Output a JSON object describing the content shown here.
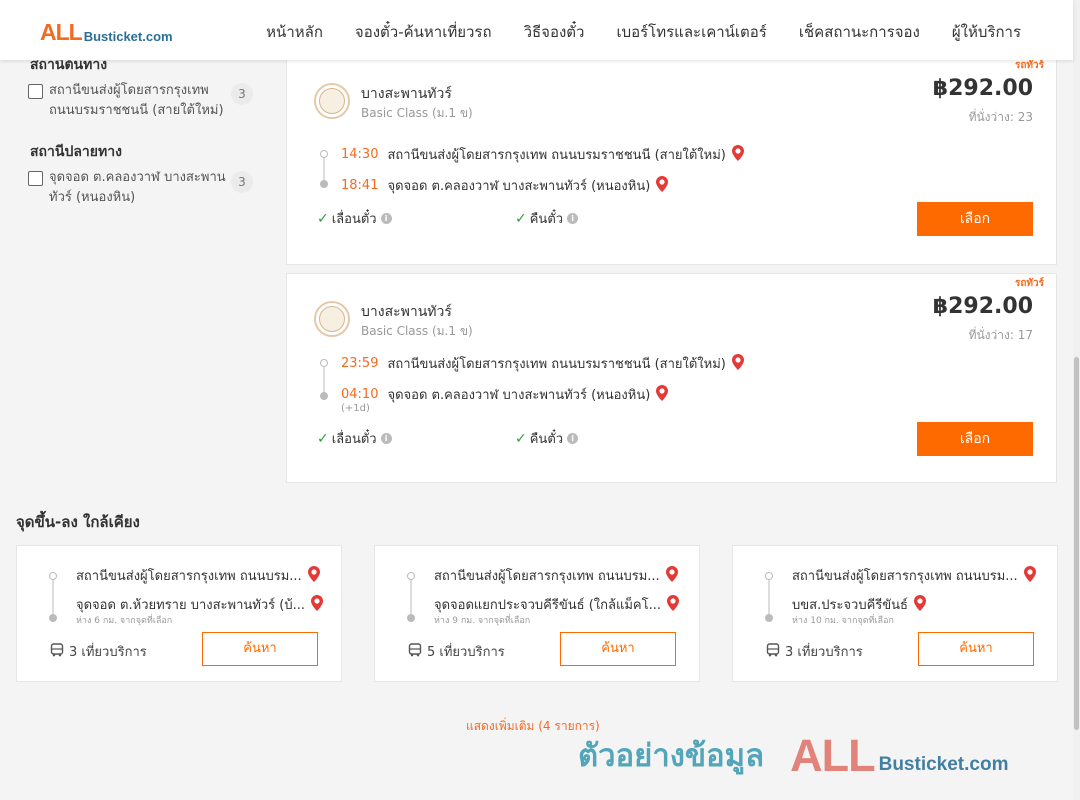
{
  "header": {
    "logo_all": "ALL",
    "logo_rest": "Busticket.com",
    "nav": [
      "หน้าหลัก",
      "จองตั๋ว-ค้นหาเที่ยวรถ",
      "วิธีจองตั๋ว",
      "เบอร์โทรและเคาน์เตอร์",
      "เช็คสถานะการจอง",
      "ผู้ให้บริการ"
    ]
  },
  "filters": {
    "origin_heading": "สถานีต้นทาง",
    "origin_items": [
      {
        "label": "สถานีขนส่งผู้โดยสารกรุงเทพ ถนนบรมราชชนนี (สายใต้ใหม่)",
        "count": "3"
      }
    ],
    "destination_heading": "สถานีปลายทาง",
    "destination_items": [
      {
        "label": "จุดจอด ต.คลองวาฬ บางสะพานทัวร์ (หนองหิน)",
        "count": "3"
      }
    ]
  },
  "trips": [
    {
      "tag": "รถทัวร์",
      "operator": "บางสะพานทัวร์",
      "class": "Basic Class (ม.1 ข)",
      "price": "฿292.00",
      "seats": "ที่นั่งว่าง: 23",
      "depart_time": "14:30",
      "depart_station": "สถานีขนส่งผู้โดยสารกรุงเทพ ถนนบรมราชชนนี (สายใต้ใหม่)",
      "arrive_time": "18:41",
      "arrive_station": "จุดจอด ต.คลองวาฬ บางสะพานทัวร์ (หนองหิน)",
      "next_day": "",
      "feature_1": "เลื่อนตั๋ว",
      "feature_2": "คืนตั๋ว",
      "select_label": "เลือก"
    },
    {
      "tag": "รถทัวร์",
      "operator": "บางสะพานทัวร์",
      "class": "Basic Class (ม.1 ข)",
      "price": "฿292.00",
      "seats": "ที่นั่งว่าง: 17",
      "depart_time": "23:59",
      "depart_station": "สถานีขนส่งผู้โดยสารกรุงเทพ ถนนบรมราชชนนี (สายใต้ใหม่)",
      "arrive_time": "04:10",
      "arrive_station": "จุดจอด ต.คลองวาฬ บางสะพานทัวร์ (หนองหิน)",
      "next_day": "(+1d)",
      "feature_1": "เลื่อนตั๋ว",
      "feature_2": "คืนตั๋ว",
      "select_label": "เลือก"
    }
  ],
  "nearby": {
    "title": "จุดขึ้น-ลง ใกล้เคียง",
    "items": [
      {
        "from": "สถานีขนส่งผู้โดยสารกรุงเทพ ถนนบรม...",
        "to": "จุดจอด ต.ห้วยทราย บางสะพานทัวร์ (บ้...",
        "distance": "ห่าง 6 กม. จากจุดที่เลือก",
        "trips": "3 เที่ยวบริการ",
        "search_label": "ค้นหา"
      },
      {
        "from": "สถานีขนส่งผู้โดยสารกรุงเทพ ถนนบรม...",
        "to": "จุดจอดแยกประจวบคีรีขันธ์ (ใกล้แม็คโ...",
        "distance": "ห่าง 9 กม. จากจุดที่เลือก",
        "trips": "5 เที่ยวบริการ",
        "search_label": "ค้นหา"
      },
      {
        "from": "สถานีขนส่งผู้โดยสารกรุงเทพ ถนนบรม...",
        "to": "บขส.ประจวบคีรีขันธ์",
        "distance": "ห่าง 10 กม. จากจุดที่เลือก",
        "trips": "3 เที่ยวบริการ",
        "search_label": "ค้นหา"
      }
    ]
  },
  "show_more": "แสดงเพิ่มเติม (4 รายการ)",
  "watermark": {
    "text": "ตัวอย่างข้อมูล",
    "all": "ALL",
    "rest": "Busticket.com"
  },
  "colors": {
    "accent": "#ff6a00",
    "time": "#f36b21",
    "check": "#2aa13a",
    "pin": "#e53935"
  },
  "icons": [
    "map-pin-icon",
    "check-icon",
    "info-icon",
    "bus-icon",
    "operator-logo"
  ]
}
